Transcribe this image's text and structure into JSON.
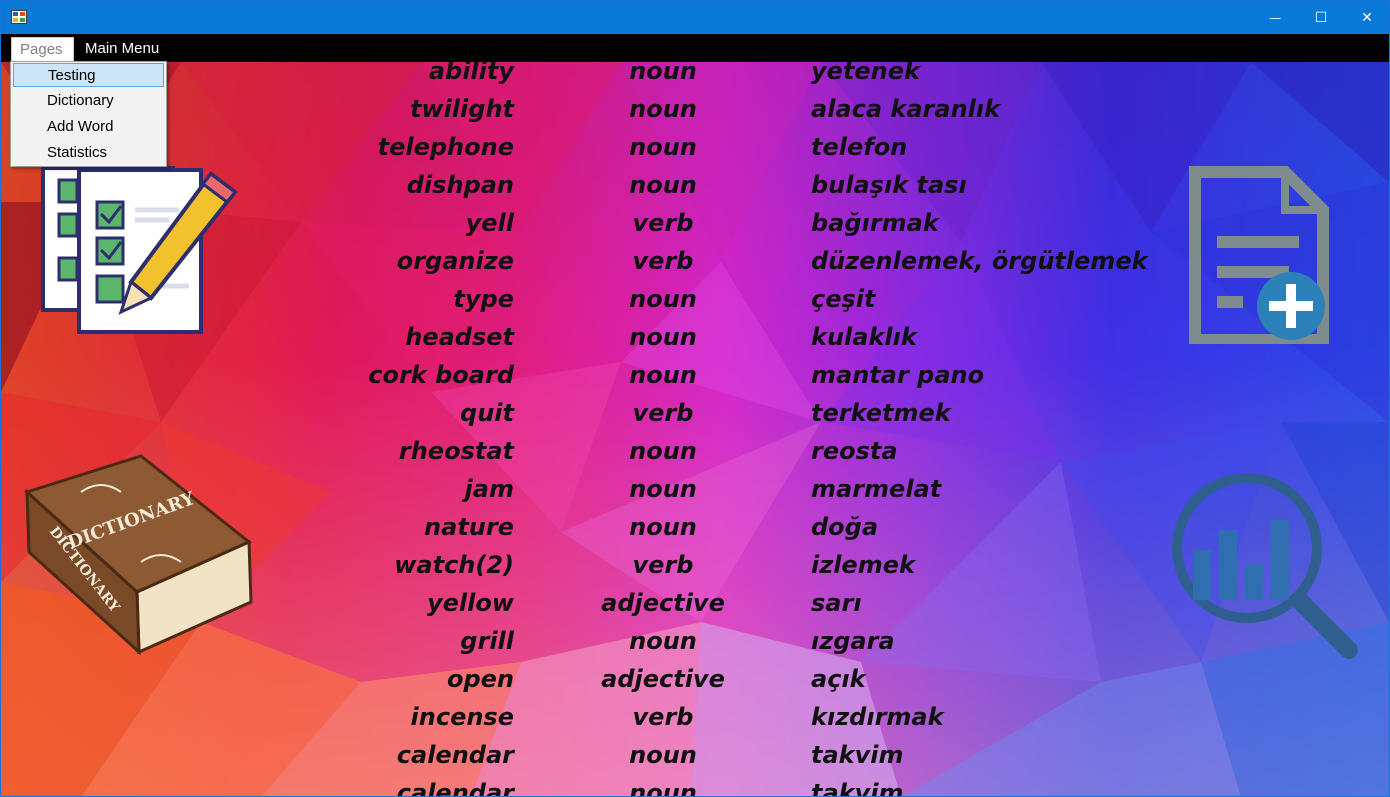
{
  "window": {
    "controls": {
      "minimize": "—",
      "maximize": "☐",
      "close": "✕"
    }
  },
  "menubar": {
    "pages_label": "Pages",
    "main_menu_label": "Main Menu"
  },
  "pages_menu": {
    "items": [
      "Testing",
      "Dictionary",
      "Add Word",
      "Statistics"
    ],
    "highlighted": "Testing"
  },
  "side_icons": {
    "testing": "checklist-pencil-icon",
    "dictionary": "dictionary-book-icon",
    "add_word": "document-add-icon",
    "statistics": "magnifier-chart-icon",
    "book_title": "DICTIONARY",
    "book_spine": "DICTIONARY"
  },
  "colors": {
    "titlebar": "#0a78d7",
    "menubar": "#000000",
    "text": "#111111",
    "doc_icon": "#7f8c8d",
    "plus_circle": "#2c82b8",
    "chart_icon": "#2f5f8f"
  },
  "words": [
    {
      "en": "ability",
      "type": "noun",
      "tr": "yetenek"
    },
    {
      "en": "twilight",
      "type": "noun",
      "tr": "alaca karanlık"
    },
    {
      "en": "telephone",
      "type": "noun",
      "tr": "telefon"
    },
    {
      "en": "dishpan",
      "type": "noun",
      "tr": "bulaşık tası"
    },
    {
      "en": "yell",
      "type": "verb",
      "tr": "bağırmak"
    },
    {
      "en": "organize",
      "type": "verb",
      "tr": "düzenlemek, örgütlemek"
    },
    {
      "en": "type",
      "type": "noun",
      "tr": "çeşit"
    },
    {
      "en": "headset",
      "type": "noun",
      "tr": "kulaklık"
    },
    {
      "en": "cork board",
      "type": "noun",
      "tr": "mantar pano"
    },
    {
      "en": "quit",
      "type": "verb",
      "tr": "terketmek"
    },
    {
      "en": "rheostat",
      "type": "noun",
      "tr": "reosta"
    },
    {
      "en": "jam",
      "type": "noun",
      "tr": "marmelat"
    },
    {
      "en": "nature",
      "type": "noun",
      "tr": "doğa"
    },
    {
      "en": "watch(2)",
      "type": "verb",
      "tr": "izlemek"
    },
    {
      "en": "yellow",
      "type": "adjective",
      "tr": "sarı"
    },
    {
      "en": "grill",
      "type": "noun",
      "tr": "ızgara"
    },
    {
      "en": "open",
      "type": "adjective",
      "tr": "açık"
    },
    {
      "en": "incense",
      "type": "verb",
      "tr": "kızdırmak"
    },
    {
      "en": "calendar",
      "type": "noun",
      "tr": "takvim"
    },
    {
      "en": "calendar",
      "type": "noun",
      "tr": "takvim"
    }
  ]
}
